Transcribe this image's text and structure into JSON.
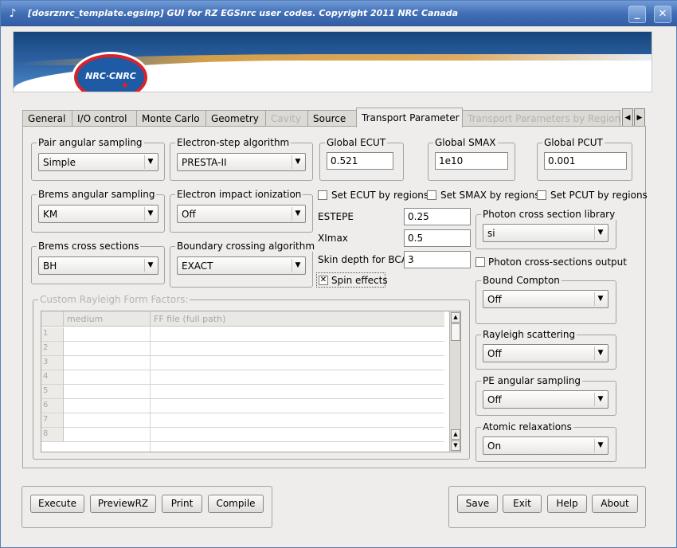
{
  "window": {
    "title": "[dosrznrc_template.egsinp] GUI for RZ EGSnrc user codes. Copyright 2011 NRC Canada",
    "minimize_label": "_",
    "close_label": "✕"
  },
  "banner": {
    "logo_text": "NRC·CNRC"
  },
  "tabs": [
    {
      "label": "General",
      "enabled": true
    },
    {
      "label": "I/O control",
      "enabled": true
    },
    {
      "label": "Monte Carlo",
      "enabled": true
    },
    {
      "label": "Geometry",
      "enabled": true
    },
    {
      "label": "Cavity",
      "enabled": false
    },
    {
      "label": "Source",
      "enabled": true
    },
    {
      "label": "Transport Parameter",
      "enabled": true,
      "active": true
    },
    {
      "label": "Transport Parameters by Region",
      "enabled": false
    }
  ],
  "transport": {
    "pair_angular_sampling": {
      "label": "Pair angular sampling",
      "value": "Simple"
    },
    "electron_step_algorithm": {
      "label": "Electron-step algorithm",
      "value": "PRESTA-II"
    },
    "brems_angular_sampling": {
      "label": "Brems angular sampling",
      "value": "KM"
    },
    "electron_impact_ionization": {
      "label": "Electron impact ionization",
      "value": "Off"
    },
    "brems_cross_sections": {
      "label": "Brems cross sections",
      "value": "BH"
    },
    "boundary_crossing_algorithm": {
      "label": "Boundary crossing algorithm",
      "value": "EXACT"
    },
    "global_ecut": {
      "label": "Global ECUT",
      "value": "0.521"
    },
    "global_smax": {
      "label": "Global SMAX",
      "value": "1e10"
    },
    "global_pcut": {
      "label": "Global PCUT",
      "value": "0.001"
    },
    "set_ecut_by_regions": {
      "label": "Set ECUT by regions",
      "checked": false
    },
    "set_smax_by_regions": {
      "label": "Set SMAX by regions",
      "checked": false
    },
    "set_pcut_by_regions": {
      "label": "Set PCUT by regions",
      "checked": false
    },
    "estepe": {
      "label": "ESTEPE",
      "value": "0.25"
    },
    "ximax": {
      "label": "XImax",
      "value": "0.5"
    },
    "skin_depth": {
      "label": "Skin depth for BCA",
      "value": "3"
    },
    "spin_effects": {
      "label": "Spin effects",
      "checked": true,
      "mark": "✕"
    },
    "photon_cross_section_library": {
      "label": "Photon cross section library",
      "value": "si"
    },
    "photon_cross_sections_output": {
      "label": "Photon cross-sections output",
      "checked": false
    },
    "bound_compton": {
      "label": "Bound Compton",
      "value": "Off"
    },
    "rayleigh_scattering": {
      "label": "Rayleigh scattering",
      "value": "Off"
    },
    "pe_angular_sampling": {
      "label": "PE angular sampling",
      "value": "Off"
    },
    "atomic_relaxations": {
      "label": "Atomic relaxations",
      "value": "On"
    }
  },
  "rayleigh_ff": {
    "label": "Custom Rayleigh Form Factors:",
    "columns": [
      "medium",
      "FF file (full path)"
    ],
    "rows": [
      "1",
      "2",
      "3",
      "4",
      "5",
      "6",
      "7",
      "8"
    ]
  },
  "buttons": {
    "execute": "Execute",
    "preview": "PreviewRZ",
    "print": "Print",
    "compile": "Compile",
    "save": "Save",
    "exit": "Exit",
    "help": "Help",
    "about": "About"
  },
  "icons": {
    "dropdown_arrow": "▼",
    "scroll_up": "▲",
    "scroll_down": "▼",
    "tab_scroll_left": "◀",
    "tab_scroll_right": "▶",
    "app_icon": "♪"
  }
}
